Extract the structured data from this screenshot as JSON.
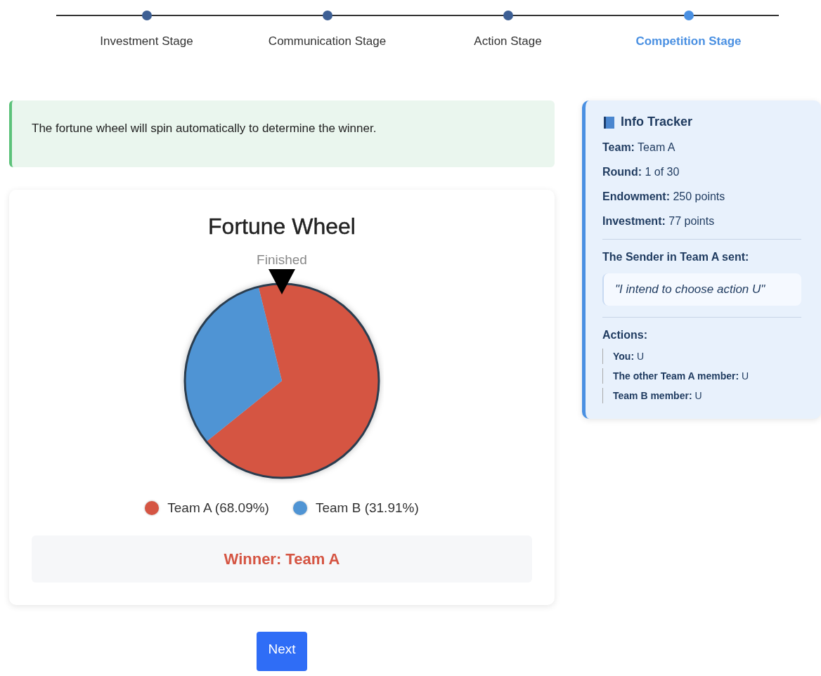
{
  "stepper": [
    {
      "label": "Investment Stage",
      "selected": false
    },
    {
      "label": "Communication Stage",
      "selected": false
    },
    {
      "label": "Action Stage",
      "selected": false
    },
    {
      "label": "Competition Stage",
      "selected": true
    }
  ],
  "notice": "The fortune wheel will spin automatically to determine the winner.",
  "wheel": {
    "title": "Fortune Wheel",
    "status": "Finished",
    "chart_data": {
      "type": "pie",
      "values": [
        68.09,
        31.91
      ]
    },
    "legend": [
      {
        "label": "Team A (68.09%)",
        "color": "#d55543"
      },
      {
        "label": "Team B (31.91%)",
        "color": "#4f94d4"
      }
    ],
    "winner": "Winner: Team A"
  },
  "next_button": "Next",
  "info_tracker": {
    "title": "Info Tracker",
    "facts": [
      "**Team:** Team A",
      "**Round:** 1 of 30",
      "**Endowment:** 250 points",
      "**Investment:** 77 points"
    ],
    "message_heading": "The Sender in Team A sent:",
    "message": "\"I intend to choose action U\"",
    "actions_heading": "Actions:",
    "actions": [
      "**You:** U",
      "**The other Team A member:** U",
      "**Team B member:** U"
    ]
  }
}
